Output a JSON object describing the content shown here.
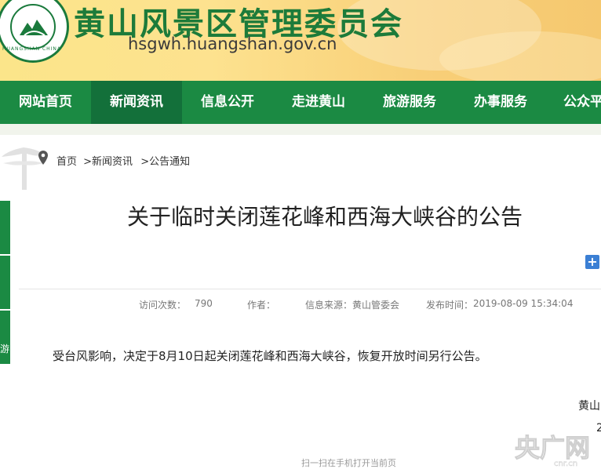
{
  "header": {
    "title": "黄山风景区管理委员会",
    "url": "hsgwh.huangshan.gov.cn",
    "seal_text": "HUANGSHAN CHINA"
  },
  "nav": {
    "items": [
      {
        "label": "网站首页",
        "active": false
      },
      {
        "label": "新闻资讯",
        "active": true
      },
      {
        "label": "信息公开",
        "active": false
      },
      {
        "label": "走进黄山",
        "active": false
      },
      {
        "label": "旅游服务",
        "active": false
      },
      {
        "label": "办事服务",
        "active": false
      },
      {
        "label": "公众平",
        "active": false
      }
    ]
  },
  "breadcrumb": {
    "items": [
      "首页",
      ">新闻资讯",
      ">公告通知"
    ]
  },
  "side": {
    "label": "游"
  },
  "article": {
    "title": "关于临时关闭莲花峰和西海大峡谷的公告",
    "meta": {
      "views_label": "访问次数：",
      "views_value": "790",
      "author_label": "作者：",
      "author_value": "",
      "source_label": "信息来源：",
      "source_value": "黄山管委会",
      "date_label": "发布时间：",
      "date_value": "2019-08-09 15:34:04"
    },
    "body": "受台风影响，决定于8月10日起关闭莲花峰和西海大峡谷，恢复开放时间另行公告。",
    "sign_org": "黄山",
    "sign_date": "2"
  },
  "footer": {
    "qr_hint": "扫一扫在手机打开当前页"
  },
  "watermark": {
    "text": "央广网",
    "sub": "cnr.cn"
  },
  "colors": {
    "nav_green": "#1b8a43",
    "nav_active": "#13703a",
    "title_green": "#1d7b3a",
    "banner_yellow": "#fde28f"
  }
}
